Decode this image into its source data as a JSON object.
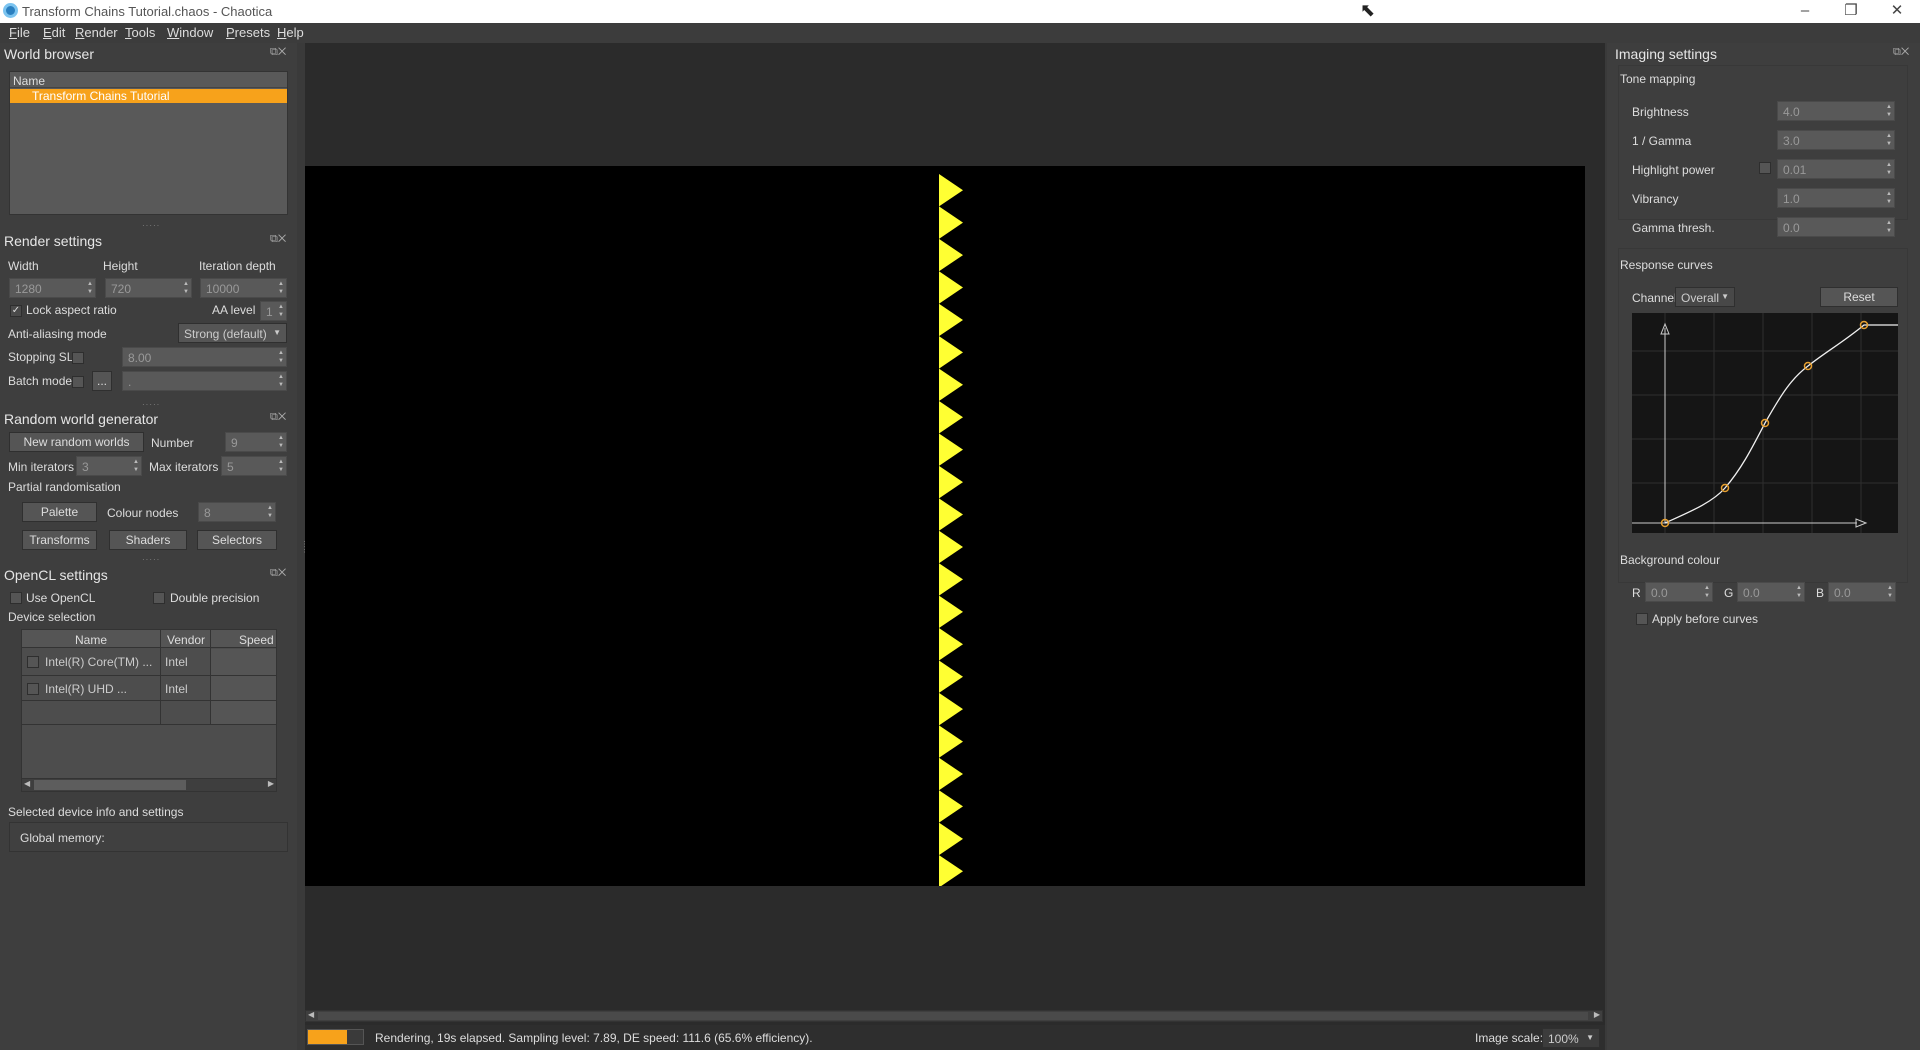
{
  "window": {
    "title": "Transform Chains Tutorial.chaos - Chaotica",
    "minimize": "–",
    "maximize": "❐",
    "close": "✕"
  },
  "menu": [
    "File",
    "Edit",
    "Render",
    "Tools",
    "Window",
    "Presets",
    "Help"
  ],
  "world_browser": {
    "title": "World browser",
    "column": "Name",
    "selected_item": "Transform Chains Tutorial"
  },
  "render_settings": {
    "title": "Render settings",
    "width_label": "Width",
    "height_label": "Height",
    "depth_label": "Iteration depth",
    "width": "1280",
    "height": "720",
    "depth": "10000",
    "lock_label": "Lock aspect ratio",
    "aa_level_label": "AA level",
    "aa_level": "1",
    "aa_mode_label": "Anti-aliasing mode",
    "aa_mode": "Strong (default)",
    "stopping_label": "Stopping SL",
    "stopping_value": "8.00",
    "batch_label": "Batch mode",
    "batch_btn": "...",
    "batch_value": "."
  },
  "random_world": {
    "title": "Random world generator",
    "new_btn": "New random worlds",
    "number_label": "Number",
    "number": "9",
    "min_label": "Min iterators",
    "min": "3",
    "max_label": "Max iterators",
    "max": "5",
    "partial_label": "Partial randomisation",
    "palette_btn": "Palette",
    "colour_nodes_label": "Colour nodes",
    "colour_nodes": "8",
    "transforms_btn": "Transforms",
    "shaders_btn": "Shaders",
    "selectors_btn": "Selectors"
  },
  "opencl": {
    "title": "OpenCL settings",
    "use_label": "Use OpenCL",
    "double_label": "Double precision",
    "device_sel_label": "Device selection",
    "cols": [
      "Name",
      "Vendor",
      "Speed"
    ],
    "devices": [
      {
        "name": "Intel(R) Core(TM) ...",
        "vendor": "Intel"
      },
      {
        "name": "Intel(R) UHD ...",
        "vendor": "Intel"
      }
    ],
    "selected_info_label": "Selected device info and settings",
    "global_mem_label": "Global memory:"
  },
  "imaging": {
    "title": "Imaging settings",
    "tone_label": "Tone mapping",
    "rows": [
      {
        "label": "Brightness",
        "value": "4.0"
      },
      {
        "label": "1 / Gamma",
        "value": "3.0"
      },
      {
        "label": "Highlight power",
        "value": "0.01"
      },
      {
        "label": "Vibrancy",
        "value": "1.0"
      },
      {
        "label": "Gamma thresh.",
        "value": "0.0"
      }
    ],
    "curves_label": "Response curves",
    "channel_label": "Channel:",
    "channel": "Overall",
    "reset_btn": "Reset",
    "bg_label": "Background colour",
    "r_label": "R",
    "r": "0.0",
    "g_label": "G",
    "g": "0.0",
    "b_label": "B",
    "b": "0.0",
    "apply_label": "Apply before curves"
  },
  "status": {
    "text": "Rendering, 19s elapsed. Sampling level: 7.89, DE speed: 111.6 (65.6% efficiency).",
    "progress": 0.7,
    "scale_label": "Image scale:",
    "scale": "100%"
  },
  "colors": {
    "accent": "#f7a21b",
    "triangle": "#ffff33"
  },
  "render_image": {
    "triangle_count": 22
  }
}
